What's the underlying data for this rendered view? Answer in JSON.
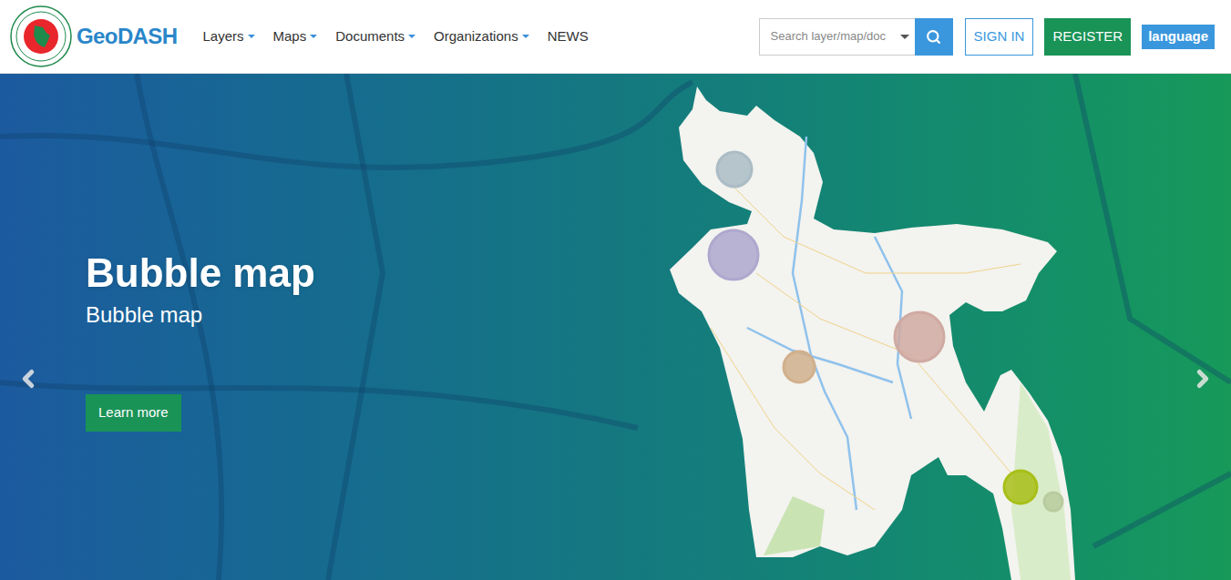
{
  "logo": {
    "name": "GeoDASH"
  },
  "nav": [
    {
      "label": "Layers",
      "dropdown": true
    },
    {
      "label": "Maps",
      "dropdown": true
    },
    {
      "label": "Documents",
      "dropdown": true
    },
    {
      "label": "Organizations",
      "dropdown": true
    },
    {
      "label": "NEWS",
      "dropdown": false
    }
  ],
  "search": {
    "placeholder": "Search layer/map/doc"
  },
  "buttons": {
    "sign_in": "SIGN IN",
    "register": "REGISTER",
    "language": "language"
  },
  "hero": {
    "title": "Bubble map",
    "subtitle": "Bubble map",
    "button": "Learn more"
  },
  "bubbles": [
    {
      "value": 19,
      "color": "#c9dde8"
    },
    {
      "value": 27,
      "color": "#cdc6f2"
    },
    {
      "value": 27,
      "color": "#f4c8bf"
    },
    {
      "value": 17,
      "color": "#f5cfa5"
    },
    {
      "value": 18,
      "color": "#c6e11c"
    },
    {
      "value": 10,
      "color": "#d8f0bb"
    }
  ]
}
